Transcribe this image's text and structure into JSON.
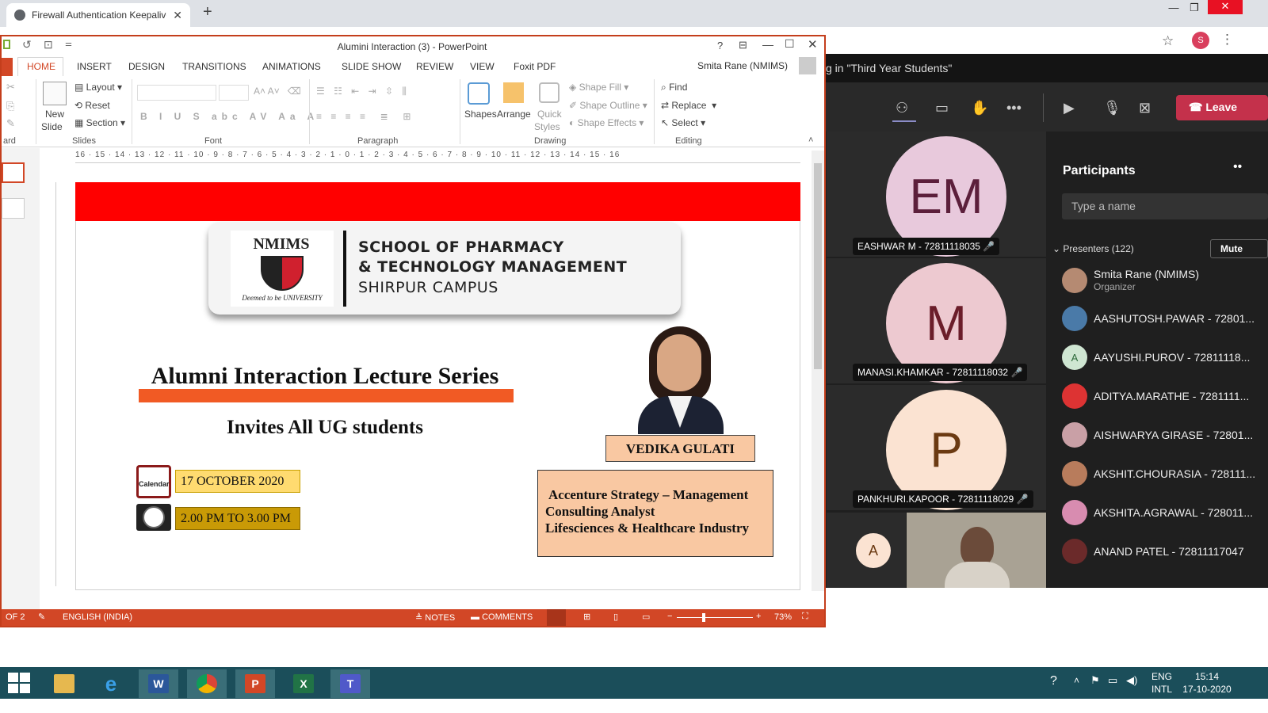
{
  "browser": {
    "tab_title": "Firewall Authentication Keepalive",
    "tab_close": "✕",
    "new_tab": "+",
    "profile_initial": "S"
  },
  "teams": {
    "header_text": "g in \"Third Year Students\"",
    "leave_label": "Leave",
    "tiles": [
      {
        "initials": "EM",
        "name": "EASHWAR M - 72811118035",
        "avatar_color": "#e8c9dc",
        "text_color": "#5c1f3b"
      },
      {
        "initials": "M",
        "name": "MANASI.KHAMKAR - 72811118032",
        "avatar_color": "#edc9d0",
        "text_color": "#6b1d2a"
      },
      {
        "initials": "P",
        "name": "PANKHURI.KAPOOR - 72811118029",
        "avatar_color": "#fbe3d2",
        "text_color": "#6b3a12"
      }
    ],
    "self_initial": "A",
    "participants": {
      "title": "Participants",
      "search_placeholder": "Type a name",
      "presenters_label": "Presenters (122)",
      "mute_label": "Mute",
      "list": [
        {
          "name": "Smita Rane (NMIMS)",
          "sub": "Organizer"
        },
        {
          "name": "AASHUTOSH.PAWAR - 72801..."
        },
        {
          "name": "AAYUSHI.PUROV - 72811118..."
        },
        {
          "name": "ADITYA.MARATHE - 7281111..."
        },
        {
          "name": "AISHWARYA GIRASE - 72801..."
        },
        {
          "name": "AKSHIT.CHOURASIA - 728111..."
        },
        {
          "name": "AKSHITA.AGRAWAL - 728011..."
        },
        {
          "name": "ANAND PATEL - 72811117047"
        }
      ]
    }
  },
  "ppt": {
    "window_title": "Alumini Interaction (3) - PowerPoint",
    "user": "Smita Rane (NMIMS)",
    "tabs": [
      "HOME",
      "INSERT",
      "DESIGN",
      "TRANSITIONS",
      "ANIMATIONS",
      "SLIDE SHOW",
      "REVIEW",
      "VIEW",
      "Foxit PDF"
    ],
    "ribbon": {
      "clipboard_label": "ard",
      "new_slide": "New",
      "new_slide2": "Slide",
      "layout": "Layout",
      "reset": "Reset",
      "section": "Section",
      "slides_label": "Slides",
      "font_label": "Font",
      "paragraph_label": "Paragraph",
      "shapes": "Shapes",
      "arrange": "Arrange",
      "quick": "Quick",
      "styles": "Styles",
      "shape_fill": "Shape Fill",
      "shape_outline": "Shape Outline",
      "shape_effects": "Shape Effects",
      "drawing_label": "Drawing",
      "find": "Find",
      "replace": "Replace",
      "select": "Select",
      "editing_label": "Editing"
    },
    "ruler": "16 · 15 · 14 · 13 · 12 · 11 · 10 · 9 · 8 · 7 · 6 · 5 · 4 · 3 · 2 · 1 · 0 · 1 · 2 · 3 · 4 · 5 · 6 · 7 · 8 · 9 · 10 · 11 · 12 · 13 · 14 · 15 · 16",
    "status": {
      "slide": "OF 2",
      "language": "ENGLISH (INDIA)",
      "notes": "NOTES",
      "comments": "COMMENTS",
      "zoom": "73%"
    }
  },
  "slide": {
    "logo_text": "NMIMS",
    "logo_sub": "Deemed to be UNIVERSITY",
    "school_line1": "SCHOOL OF PHARMACY",
    "school_line2": "& TECHNOLOGY MANAGEMENT",
    "school_line3": "SHIRPUR CAMPUS",
    "lecture_title": "Alumni Interaction Lecture Series",
    "invites": "Invites All UG students",
    "calendar_label": "Calendar",
    "date": "17 OCTOBER 2020",
    "time": "2.00 PM TO 3.00 PM",
    "speaker": "VEDIKA GULATI",
    "desc1": "Accenture Strategy – Management",
    "desc2": "Consulting Analyst",
    "desc3": "Lifesciences & Healthcare Industry"
  },
  "taskbar": {
    "lang1": "ENG",
    "lang2": "INTL",
    "time": "15:14",
    "date": "17-10-2020"
  }
}
